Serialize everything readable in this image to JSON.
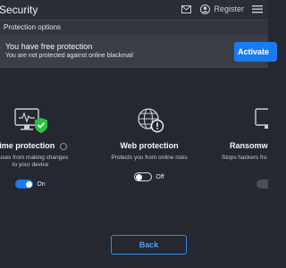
{
  "window": {
    "title": "Security"
  },
  "header": {
    "register_label": "Register"
  },
  "options": {
    "title": "Protection options"
  },
  "banner": {
    "title": "You have free protection",
    "subtitle": "You are not protected against online blackmail",
    "activate_label": "Activate"
  },
  "cards": [
    {
      "title": "-time protection",
      "desc_line1": "viruses from making changes",
      "desc_line2": "to your device",
      "state": "On"
    },
    {
      "title": "Web protection",
      "desc_line1": "Protects you from online risks",
      "desc_line2": "",
      "state": "Off"
    },
    {
      "title": "Ransomwa",
      "desc_line1": "Stops hackers fro",
      "desc_line2": "",
      "state": ""
    }
  ],
  "footer": {
    "back_label": "Back"
  },
  "colors": {
    "accent": "#1a7af0",
    "background": "#25282f",
    "banner": "#3a3f47",
    "shield_ok": "#2fbf47"
  },
  "icons": [
    "mail-icon",
    "account-icon",
    "hamburger-menu-icon",
    "monitor-shield-icon",
    "globe-warning-icon",
    "monitor-icon",
    "info-icon"
  ]
}
